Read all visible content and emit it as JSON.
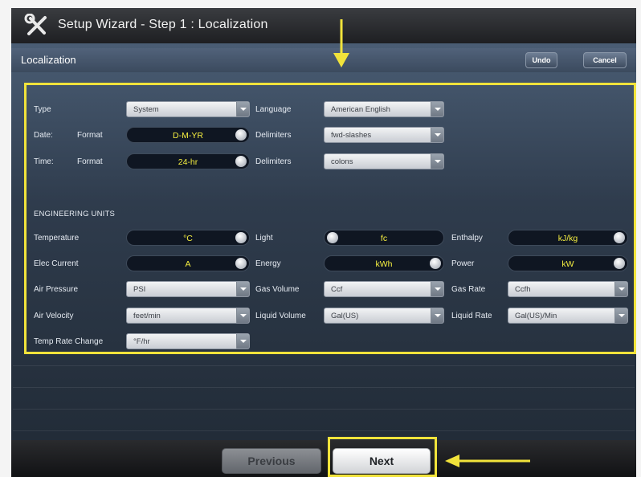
{
  "window": {
    "title": "Setup Wizard - Step 1 : Localization",
    "title_icon": "tools-icon"
  },
  "panel": {
    "title": "Localization",
    "undo_label": "Undo",
    "cancel_label": "Cancel"
  },
  "general": {
    "type_label": "Type",
    "type_value": "System",
    "language_label": "Language",
    "language_value": "American English",
    "date_label": "Date:",
    "date_format_label": "Format",
    "date_format_value": "D-M-YR",
    "date_delim_label": "Delimiters",
    "date_delim_value": "fwd-slashes",
    "time_label": "Time:",
    "time_format_label": "Format",
    "time_format_value": "24-hr",
    "time_delim_label": "Delimiters",
    "time_delim_value": "colons"
  },
  "engineering": {
    "section_title": "ENGINEERING UNITS",
    "temperature_label": "Temperature",
    "temperature_value": "°C",
    "light_label": "Light",
    "light_value": "fc",
    "enthalpy_label": "Enthalpy",
    "enthalpy_value": "kJ/kg",
    "elec_current_label": "Elec Current",
    "elec_current_value": "A",
    "energy_label": "Energy",
    "energy_value": "kWh",
    "power_label": "Power",
    "power_value": "kW",
    "air_pressure_label": "Air Pressure",
    "air_pressure_value": "PSI",
    "gas_volume_label": "Gas Volume",
    "gas_volume_value": "Ccf",
    "gas_rate_label": "Gas Rate",
    "gas_rate_value": "Ccfh",
    "air_velocity_label": "Air Velocity",
    "air_velocity_value": "feet/min",
    "liquid_volume_label": "Liquid Volume",
    "liquid_volume_value": "Gal(US)",
    "liquid_rate_label": "Liquid Rate",
    "liquid_rate_value": "Gal(US)/Min",
    "temp_rate_label": "Temp Rate Change",
    "temp_rate_value": "°F/hr"
  },
  "footer": {
    "previous_label": "Previous",
    "next_label": "Next"
  },
  "colors": {
    "highlight": "#f1e33b",
    "toggle_text": "#f5ee40",
    "panel": "#3b4a5e"
  }
}
